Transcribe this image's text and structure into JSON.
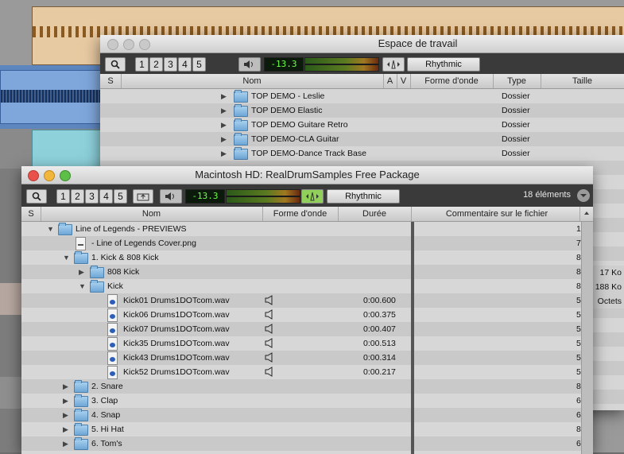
{
  "back_window": {
    "title": "Espace de travail",
    "toolbar": {
      "numbers": [
        "1",
        "2",
        "3",
        "4",
        "5"
      ],
      "counter": "-13.3",
      "preset": "Rhythmic"
    },
    "columns": [
      "S",
      "Nom",
      "A",
      "V",
      "Forme d'onde",
      "Type",
      "Taille"
    ],
    "rows": [
      {
        "name": "TOP DEMO - Leslie",
        "type": "Dossier"
      },
      {
        "name": "TOP DEMO Elastic",
        "type": "Dossier"
      },
      {
        "name": "TOP DEMO Guitare Retro",
        "type": "Dossier"
      },
      {
        "name": "TOP DEMO-CLA Guitar",
        "type": "Dossier"
      },
      {
        "name": "TOP DEMO-Dance Track Base",
        "type": "Dossier"
      }
    ],
    "size_peek": [
      "17 Ko",
      "188 Ko",
      "Octets"
    ]
  },
  "front_window": {
    "title": "Macintosh HD: RealDrumSamples Free Package",
    "toolbar": {
      "numbers": [
        "1",
        "2",
        "3",
        "4",
        "5"
      ],
      "counter": "-13.3",
      "preset": "Rhythmic",
      "item_count": "18 éléments"
    },
    "columns": [
      "S",
      "Nom",
      "Forme d'onde",
      "Durée",
      "Commentaire sur le fichier"
    ],
    "rows": [
      {
        "level": 0,
        "kind": "folder",
        "expanded": true,
        "name": "Line of Legends - PREVIEWS",
        "duration": "",
        "edge": "1"
      },
      {
        "level": 1,
        "kind": "png",
        "name": "- Line of Legends Cover.png",
        "duration": "",
        "edge": "7"
      },
      {
        "level": 1,
        "kind": "folder",
        "expanded": true,
        "name": "1. Kick & 808 Kick",
        "duration": "",
        "edge": "8"
      },
      {
        "level": 2,
        "kind": "folder",
        "expanded": false,
        "name": "808 Kick",
        "duration": "",
        "edge": "8"
      },
      {
        "level": 2,
        "kind": "folder",
        "expanded": true,
        "name": "Kick",
        "duration": "",
        "edge": "8"
      },
      {
        "level": 3,
        "kind": "audio",
        "name": "Kick01 Drums1DOTcom.wav",
        "duration": "0:00.600",
        "edge": "5"
      },
      {
        "level": 3,
        "kind": "audio",
        "name": "Kick06 Drums1DOTcom.wav",
        "duration": "0:00.375",
        "edge": "5"
      },
      {
        "level": 3,
        "kind": "audio",
        "name": "Kick07 Drums1DOTcom.wav",
        "duration": "0:00.407",
        "edge": "5"
      },
      {
        "level": 3,
        "kind": "audio",
        "name": "Kick35 Drums1DOTcom.wav",
        "duration": "0:00.513",
        "edge": "5"
      },
      {
        "level": 3,
        "kind": "audio",
        "name": "Kick43 Drums1DOTcom.wav",
        "duration": "0:00.314",
        "edge": "5"
      },
      {
        "level": 3,
        "kind": "audio",
        "name": "Kick52 Drums1DOTcom.wav",
        "duration": "0:00.217",
        "edge": "5"
      },
      {
        "level": 1,
        "kind": "folder",
        "expanded": false,
        "name": "2. Snare",
        "duration": "",
        "edge": "8"
      },
      {
        "level": 1,
        "kind": "folder",
        "expanded": false,
        "name": "3. Clap",
        "duration": "",
        "edge": "6"
      },
      {
        "level": 1,
        "kind": "folder",
        "expanded": false,
        "name": "4. Snap",
        "duration": "",
        "edge": "6"
      },
      {
        "level": 1,
        "kind": "folder",
        "expanded": false,
        "name": "5. Hi Hat",
        "duration": "",
        "edge": "8"
      },
      {
        "level": 1,
        "kind": "folder",
        "expanded": false,
        "name": "6. Tom's",
        "duration": "",
        "edge": "6"
      }
    ]
  }
}
